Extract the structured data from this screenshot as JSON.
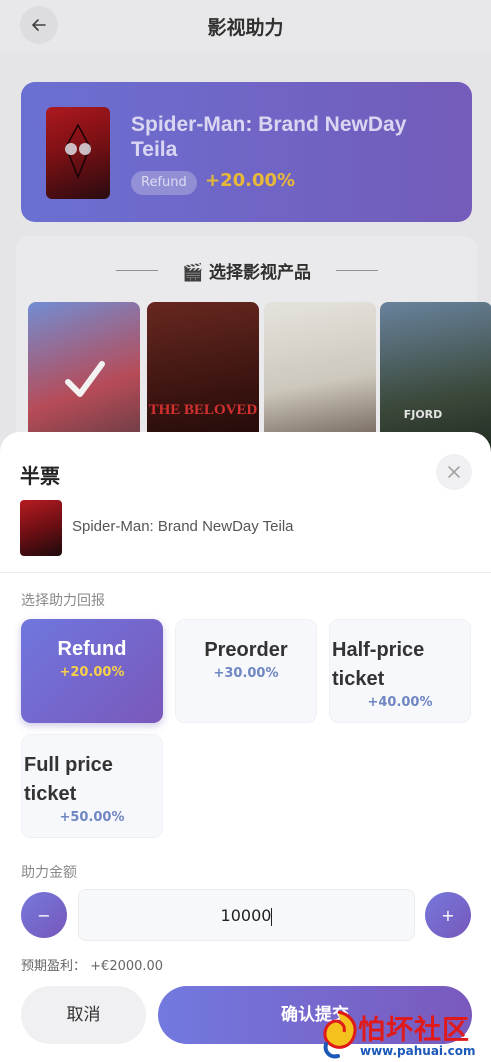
{
  "header": {
    "title": "影视助力"
  },
  "hero": {
    "movie_name": "Spider-Man: Brand NewDay Teila",
    "badge": "Refund",
    "percent": "+20.00%"
  },
  "select": {
    "title": "选择影视产品",
    "posters": [
      {
        "caption": "",
        "selected": true
      },
      {
        "caption": "THE BELOVED",
        "selected": false
      },
      {
        "caption": "",
        "selected": false
      },
      {
        "caption": "FJORD",
        "selected": false
      }
    ]
  },
  "sheet": {
    "title": "半票",
    "movie_name": "Spider-Man: Brand NewDay Teila",
    "reward_label": "选择助力回报",
    "options": [
      {
        "name": "Refund",
        "percent": "+20.00%",
        "selected": true
      },
      {
        "name": "Preorder",
        "percent": "+30.00%",
        "selected": false
      },
      {
        "name": "Half-price ticket",
        "percent": "+40.00%",
        "selected": false
      },
      {
        "name": "Full price ticket",
        "percent": "+50.00%",
        "selected": false
      }
    ],
    "amount_label": "助力金额",
    "amount_value": "10000",
    "minus": "−",
    "plus": "+",
    "expected_label": "预期盈利：",
    "expected_value": "+€2000.00",
    "cancel_label": "取消",
    "confirm_label": "确认提交"
  },
  "watermark": {
    "text": "怕坏社区",
    "url": "www.pahuai.com"
  },
  "colors": {
    "accent_start": "#7279df",
    "accent_end": "#7a59bd",
    "highlight": "#f5c33b"
  }
}
